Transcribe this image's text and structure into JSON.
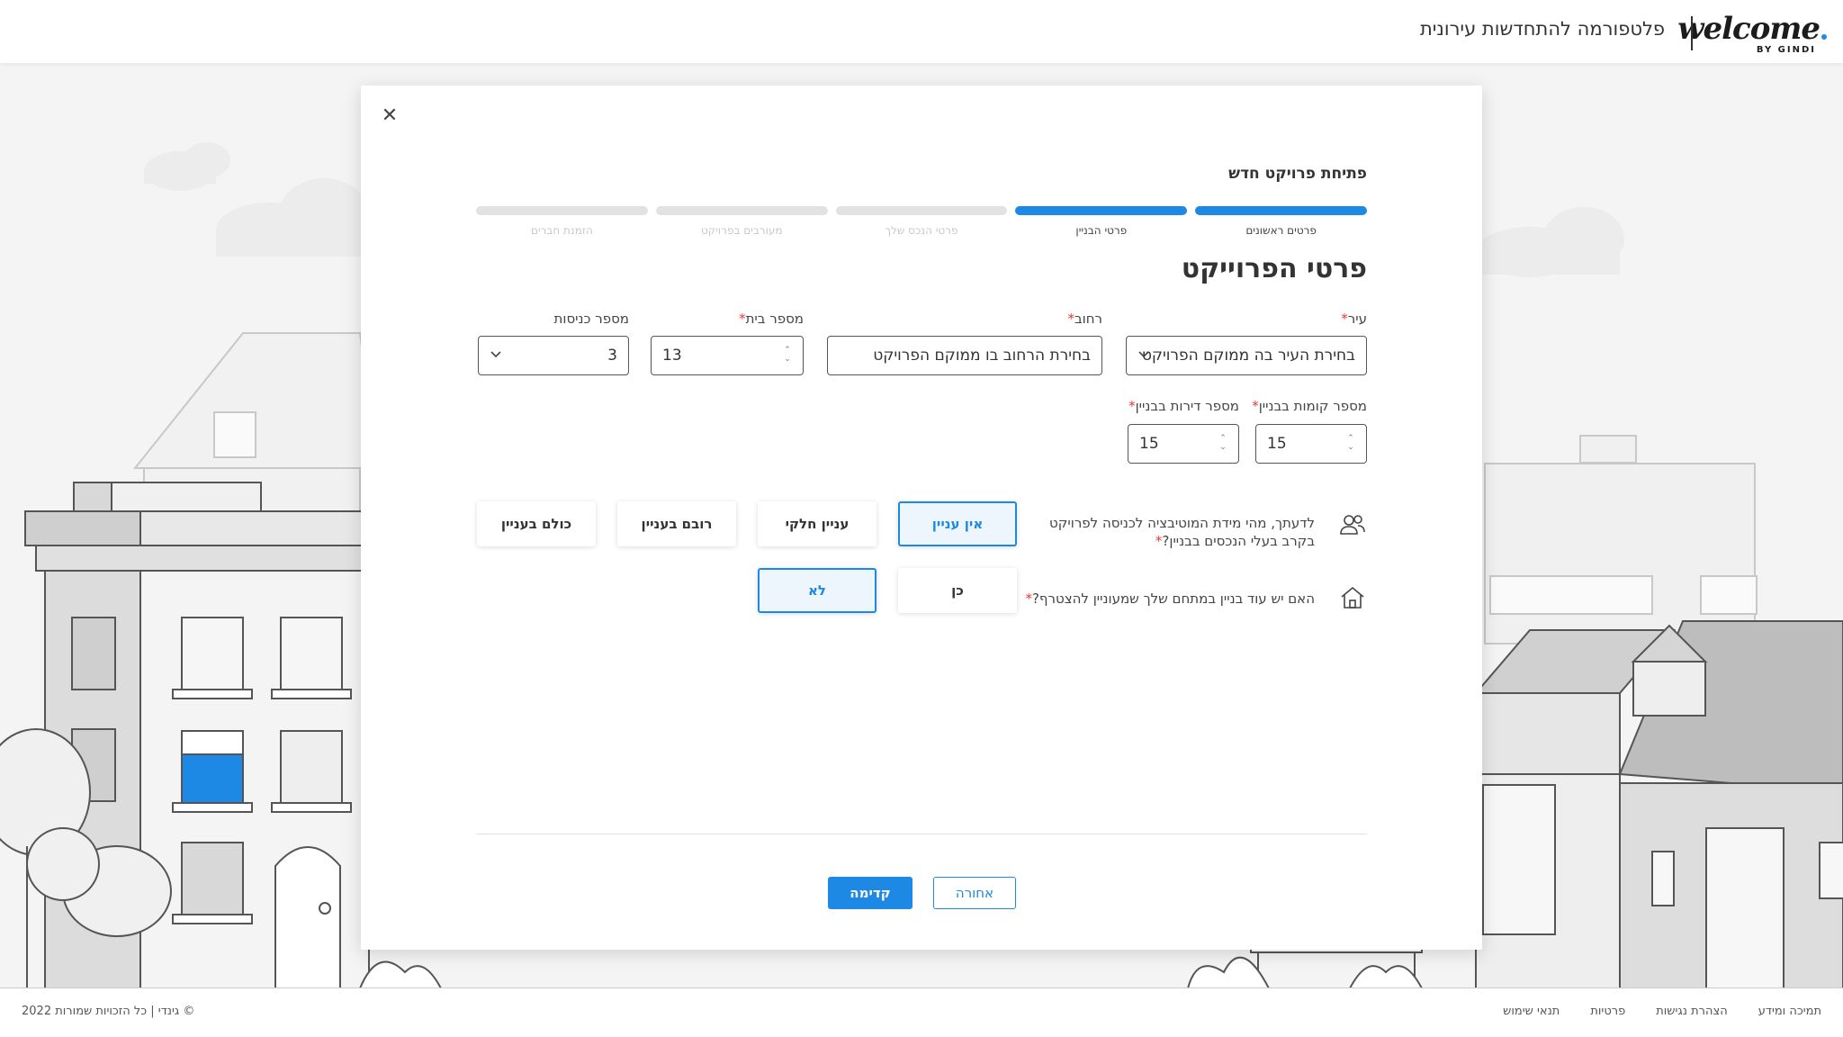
{
  "header": {
    "logo_text": "welcome",
    "logo_sub": "BY GINDI",
    "title": "פלטפורמה להתחדשות עירונית"
  },
  "modal": {
    "title": "פתיחת פרויקט חדש",
    "close_icon": "close-icon",
    "steps": [
      {
        "label": "פרטים ראשונים",
        "active": true
      },
      {
        "label": "פרטי הבניין",
        "active": true
      },
      {
        "label": "פרטי הנכס שלך",
        "active": false
      },
      {
        "label": "מעורבים בפרויקט",
        "active": false
      },
      {
        "label": "הזמנת חברים",
        "active": false
      }
    ],
    "section_title": "פרטי הפרוייקט",
    "fields": {
      "city": {
        "label": "עיר",
        "required": "*",
        "value": "בחירת העיר בה ממוקם הפרויקט"
      },
      "street": {
        "label": "רחוב",
        "required": "*",
        "value": "בחירת הרחוב בו ממוקם הפרויקט"
      },
      "house_number": {
        "label": "מספר בית",
        "required": "*",
        "value": "13"
      },
      "entrances": {
        "label": "מספר כניסות",
        "value": "3"
      },
      "floors": {
        "label": "מספר קומות בבניין",
        "required": "*",
        "value": "15"
      },
      "apartments": {
        "label": "מספר דירות בבניין",
        "required": "*",
        "value": "15"
      }
    },
    "motivation": {
      "icon": "people-icon",
      "text_line1": "לדעתך, מהי מידת המוטיבציה לכניסה לפרויקט",
      "text_line2": "בקרב בעלי הנכסים בבניין?",
      "required": "*",
      "options": [
        "אין עניין",
        "עניין חלקי",
        "רובם בעניין",
        "כולם בעניין"
      ],
      "selected": "אין עניין"
    },
    "other_building": {
      "icon": "home-icon",
      "text": "האם יש עוד בניין במתחם שלך שמעוניין להצטרף?",
      "required": "*",
      "options": [
        "כן",
        "לא"
      ],
      "selected": "לא"
    },
    "buttons": {
      "next": "קדימה",
      "back": "אחורה"
    }
  },
  "footer": {
    "copyright": "© גינדי | כל הזכויות שמורות 2022",
    "links": [
      "תנאי שימוש",
      "פרטיות",
      "הצהרת נגישות",
      "תמיכה ומידע"
    ]
  },
  "colors": {
    "accent": "#1e88e5",
    "required": "#e53935"
  }
}
